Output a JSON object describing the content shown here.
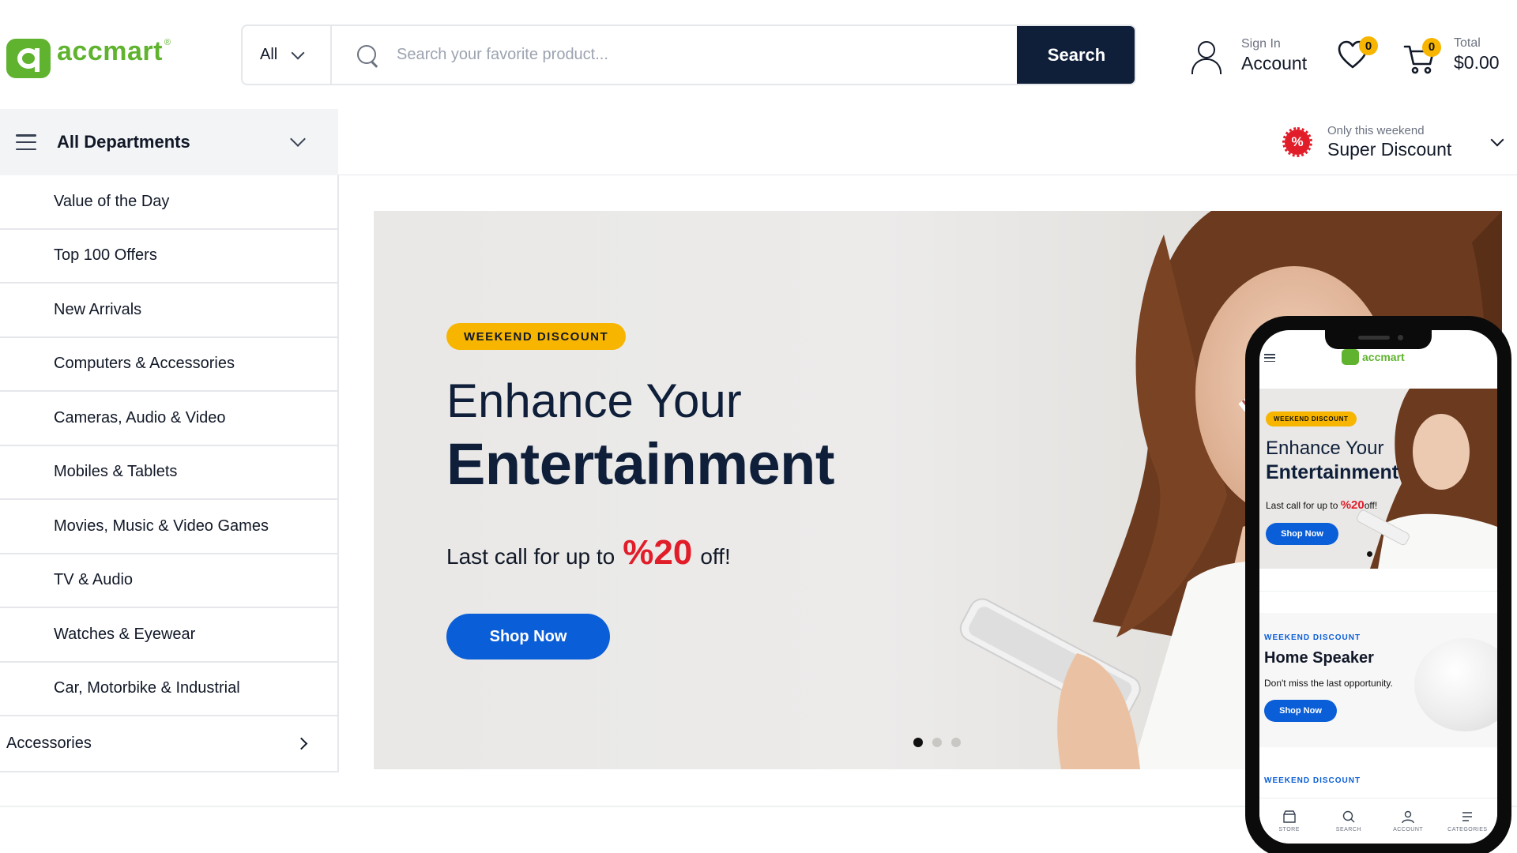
{
  "brand": {
    "name": "accmart",
    "reg": "®",
    "color": "#5fb32e"
  },
  "search": {
    "category": "All",
    "placeholder": "Search your favorite product...",
    "button_label": "Search"
  },
  "account": {
    "small": "Sign In",
    "big": "Account"
  },
  "wishlist": {
    "count": "0"
  },
  "cart": {
    "count": "0",
    "small": "Total",
    "big": "$0.00"
  },
  "departments": {
    "label": "All Departments",
    "items": [
      "Value of the Day",
      "Top 100 Offers",
      "New Arrivals",
      "Computers & Accessories",
      "Cameras, Audio & Video",
      "Mobiles & Tablets",
      "Movies, Music & Video Games",
      "TV & Audio",
      "Watches & Eyewear",
      "Car, Motorbike & Industrial"
    ],
    "last_item": "Accessories"
  },
  "promo": {
    "badge": "%",
    "small": "Only this weekend",
    "big": "Super Discount"
  },
  "hero": {
    "tag": "WEEKEND DISCOUNT",
    "title_line1": "Enhance Your",
    "title_line2": "Entertainment",
    "sub_prefix": "Last call for up to",
    "sub_pct": "%20",
    "sub_suffix": "off!",
    "button": "Shop Now",
    "slide_count": 3,
    "active_slide": 1
  },
  "phone": {
    "logo": "accmart",
    "hero": {
      "tag": "WEEKEND DISCOUNT",
      "title_line1": "Enhance Your",
      "title_line2": "Entertainment",
      "sub_prefix": "Last call for up to ",
      "sub_pct": "%20",
      "sub_suffix": "off!",
      "button": "Shop Now"
    },
    "card2": {
      "tag": "WEEKEND DISCOUNT",
      "title": "Home Speaker",
      "sub": "Don't miss the last opportunity.",
      "button": "Shop Now"
    },
    "card3": {
      "tag": "WEEKEND DISCOUNT"
    },
    "tabs": [
      "STORE",
      "SEARCH",
      "ACCOUNT",
      "CATEGORIES"
    ]
  },
  "colors": {
    "navy": "#0f1f3a",
    "accent_blue": "#0a5ed7",
    "yellow": "#f7b500",
    "red": "#e11d2a"
  }
}
